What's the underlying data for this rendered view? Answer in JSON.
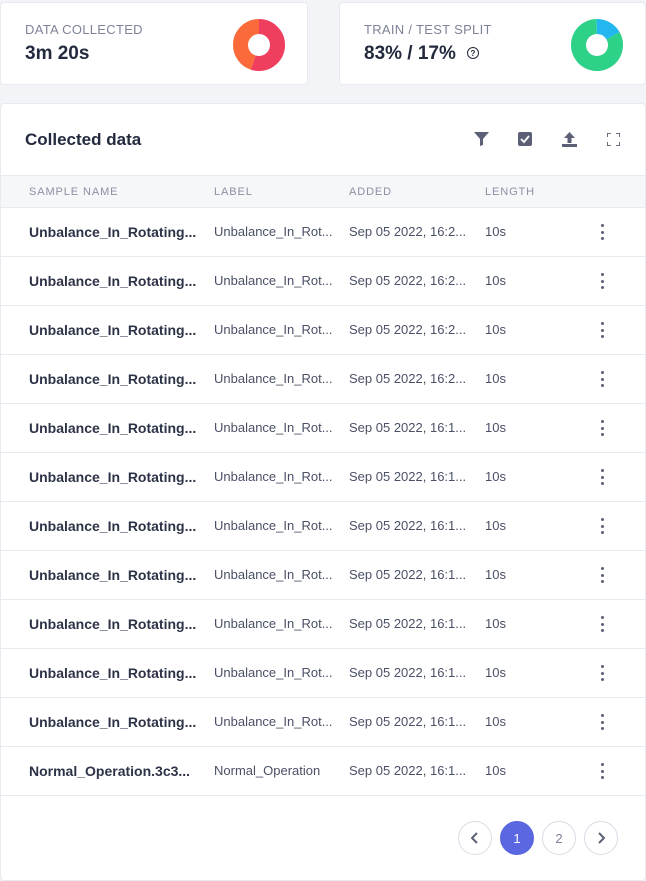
{
  "stats": {
    "collected": {
      "title": "DATA COLLECTED",
      "value": "3m 20s"
    },
    "split": {
      "title": "TRAIN / TEST SPLIT",
      "value": "83% / 17%"
    }
  },
  "collected_donut": {
    "colors": [
      "#f03e5e",
      "#fb6a3a"
    ],
    "fractions": [
      0.55,
      0.45
    ]
  },
  "split_donut": {
    "colors": [
      "#2ed188",
      "#22b7ee"
    ],
    "fractions": [
      0.83,
      0.17
    ]
  },
  "panel": {
    "title": "Collected data",
    "toolbar": [
      "filter-icon",
      "check-select-icon",
      "upload-icon",
      "fullscreen-icon"
    ]
  },
  "columns": {
    "name": "SAMPLE NAME",
    "label": "LABEL",
    "added": "ADDED",
    "length": "LENGTH"
  },
  "rows": [
    {
      "name": "Unbalance_In_Rotating...",
      "label": "Unbalance_In_Rot...",
      "added": "Sep 05 2022, 16:2...",
      "length": "10s"
    },
    {
      "name": "Unbalance_In_Rotating...",
      "label": "Unbalance_In_Rot...",
      "added": "Sep 05 2022, 16:2...",
      "length": "10s"
    },
    {
      "name": "Unbalance_In_Rotating...",
      "label": "Unbalance_In_Rot...",
      "added": "Sep 05 2022, 16:2...",
      "length": "10s"
    },
    {
      "name": "Unbalance_In_Rotating...",
      "label": "Unbalance_In_Rot...",
      "added": "Sep 05 2022, 16:2...",
      "length": "10s"
    },
    {
      "name": "Unbalance_In_Rotating...",
      "label": "Unbalance_In_Rot...",
      "added": "Sep 05 2022, 16:1...",
      "length": "10s"
    },
    {
      "name": "Unbalance_In_Rotating...",
      "label": "Unbalance_In_Rot...",
      "added": "Sep 05 2022, 16:1...",
      "length": "10s"
    },
    {
      "name": "Unbalance_In_Rotating...",
      "label": "Unbalance_In_Rot...",
      "added": "Sep 05 2022, 16:1...",
      "length": "10s"
    },
    {
      "name": "Unbalance_In_Rotating...",
      "label": "Unbalance_In_Rot...",
      "added": "Sep 05 2022, 16:1...",
      "length": "10s"
    },
    {
      "name": "Unbalance_In_Rotating...",
      "label": "Unbalance_In_Rot...",
      "added": "Sep 05 2022, 16:1...",
      "length": "10s"
    },
    {
      "name": "Unbalance_In_Rotating...",
      "label": "Unbalance_In_Rot...",
      "added": "Sep 05 2022, 16:1...",
      "length": "10s"
    },
    {
      "name": "Unbalance_In_Rotating...",
      "label": "Unbalance_In_Rot...",
      "added": "Sep 05 2022, 16:1...",
      "length": "10s"
    },
    {
      "name": "Normal_Operation.3c3...",
      "label": "Normal_Operation",
      "added": "Sep 05 2022, 16:1...",
      "length": "10s"
    }
  ],
  "pagination": {
    "pages": [
      "1",
      "2"
    ],
    "current": "1",
    "prev_icon": "chevron-left-icon",
    "next_icon": "chevron-right-icon"
  }
}
